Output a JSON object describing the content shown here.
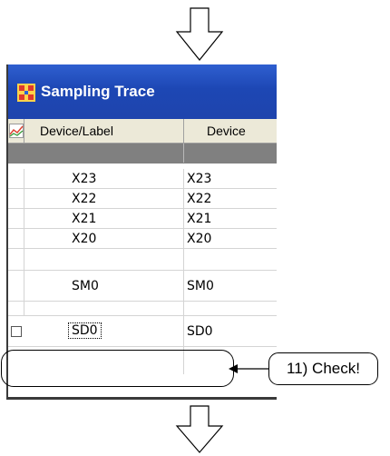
{
  "window": {
    "title": "Sampling Trace",
    "icon": "sampling-trace-app-icon"
  },
  "table": {
    "header_icon": "chart-icon",
    "columns": [
      "Device/Label",
      "Device"
    ],
    "rows": [
      {
        "label": "X23",
        "device": "X23"
      },
      {
        "label": "X22",
        "device": "X22"
      },
      {
        "label": "X21",
        "device": "X21"
      },
      {
        "label": "X20",
        "device": "X20"
      },
      {
        "label": "",
        "device": ""
      },
      {
        "label": "SM0",
        "device": "SM0"
      },
      {
        "label": "",
        "device": ""
      },
      {
        "label": "SD0",
        "device": "SD0",
        "checked": false,
        "focused": true
      }
    ]
  },
  "annotation": {
    "callout": "11) Check!"
  },
  "arrows": {
    "top": "down-arrow",
    "bottom": "down-arrow"
  },
  "colors": {
    "title_bar": "#1d47b4",
    "header_bg": "#ece9d8",
    "gray_row": "#808080"
  }
}
